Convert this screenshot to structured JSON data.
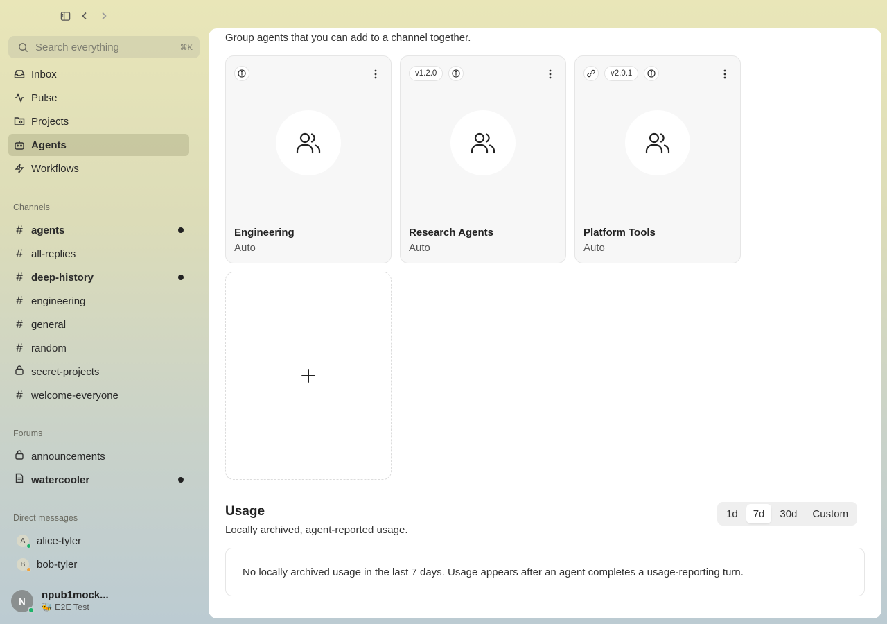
{
  "search": {
    "placeholder": "Search everything",
    "shortcut": "⌘K"
  },
  "nav": [
    {
      "label": "Inbox",
      "icon": "inbox-icon"
    },
    {
      "label": "Pulse",
      "icon": "activity-icon"
    },
    {
      "label": "Projects",
      "icon": "folder-icon"
    },
    {
      "label": "Agents",
      "icon": "bot-icon",
      "active": true
    },
    {
      "label": "Workflows",
      "icon": "bolt-icon"
    }
  ],
  "channels": {
    "label": "Channels",
    "items": [
      {
        "label": "agents",
        "bold": true,
        "unread": true
      },
      {
        "label": "all-replies"
      },
      {
        "label": "deep-history",
        "bold": true,
        "unread": true
      },
      {
        "label": "engineering"
      },
      {
        "label": "general"
      },
      {
        "label": "random"
      },
      {
        "label": "secret-projects",
        "locked": true
      },
      {
        "label": "welcome-everyone"
      }
    ]
  },
  "forums": {
    "label": "Forums",
    "items": [
      {
        "label": "announcements",
        "locked": true
      },
      {
        "label": "watercooler",
        "bold": true,
        "unread": true
      }
    ]
  },
  "dms": {
    "label": "Direct messages",
    "items": [
      {
        "label": "alice-tyler",
        "initial": "A",
        "status_color": "#1db36b"
      },
      {
        "label": "bob-tyler",
        "initial": "B",
        "status_color": "#f2a33a"
      }
    ]
  },
  "user": {
    "initial": "N",
    "name": "npub1mock...",
    "status": "🐝 E2E Test"
  },
  "main": {
    "intro": "Group agents that you can add to a channel together.",
    "teams": [
      {
        "name": "Engineering",
        "mode": "Auto",
        "version": "",
        "linked": false
      },
      {
        "name": "Research Agents",
        "mode": "Auto",
        "version": "v1.2.0",
        "linked": false
      },
      {
        "name": "Platform Tools",
        "mode": "Auto",
        "version": "v2.0.1",
        "linked": true
      }
    ],
    "usage": {
      "title": "Usage",
      "subtitle": "Locally archived, agent-reported usage.",
      "ranges": [
        "1d",
        "7d",
        "30d",
        "Custom"
      ],
      "selected": "7d",
      "empty": "No locally archived usage in the last 7 days. Usage appears after an agent completes a usage-reporting turn."
    }
  },
  "colors": {
    "accent_dot": "#222222",
    "online": "#1db36b",
    "away": "#f2a33a"
  }
}
